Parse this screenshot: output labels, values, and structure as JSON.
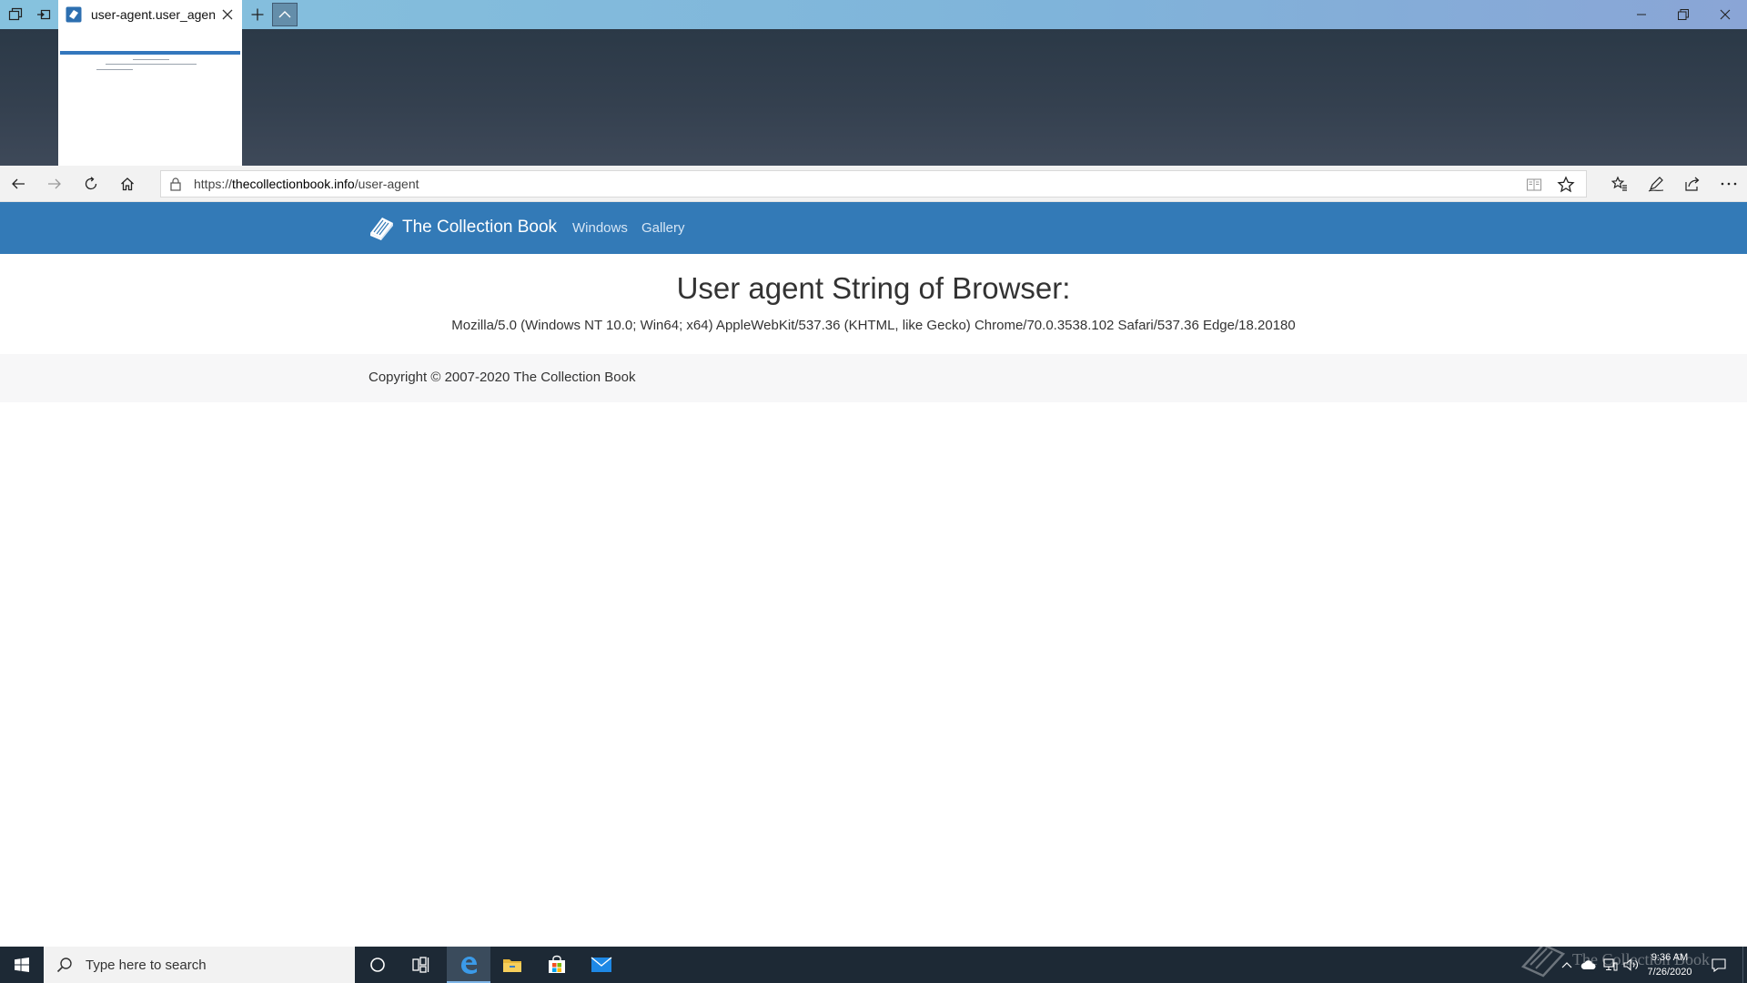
{
  "browser": {
    "tab": {
      "title": "user-agent.user_agent -"
    },
    "address": {
      "scheme": "https://",
      "host": "thecollectionbook.info",
      "path": "/user-agent"
    }
  },
  "site": {
    "brand": "The Collection Book",
    "nav": [
      "Windows",
      "Gallery"
    ],
    "heading": "User agent String of Browser:",
    "user_agent": "Mozilla/5.0 (Windows NT 10.0; Win64; x64) AppleWebKit/537.36 (KHTML, like Gecko) Chrome/70.0.3538.102 Safari/537.36 Edge/18.20180",
    "footer": "Copyright © 2007-2020 The Collection Book"
  },
  "taskbar": {
    "search_placeholder": "Type here to search",
    "time": "9:36 AM",
    "date": "7/26/2020",
    "watermark": "The Collection Book"
  },
  "colors": {
    "site_nav": "#337ab7",
    "taskbar": "#1d2935",
    "tab_gradient": "#86c2de"
  },
  "icons": {
    "tabbar": [
      "tab-list-icon",
      "set-aside-icon",
      "new-tab-icon",
      "collapse-preview-icon"
    ],
    "navbar": [
      "back-icon",
      "forward-icon",
      "refresh-icon",
      "home-icon",
      "lock-icon",
      "reading-view-icon",
      "favorite-star-icon",
      "favorites-list-icon",
      "pen-icon",
      "share-icon",
      "more-icon"
    ],
    "taskbar": [
      "windows-start-icon",
      "search-icon",
      "cortana-icon",
      "task-view-icon",
      "edge-icon",
      "file-explorer-icon",
      "store-icon",
      "mail-icon"
    ]
  }
}
